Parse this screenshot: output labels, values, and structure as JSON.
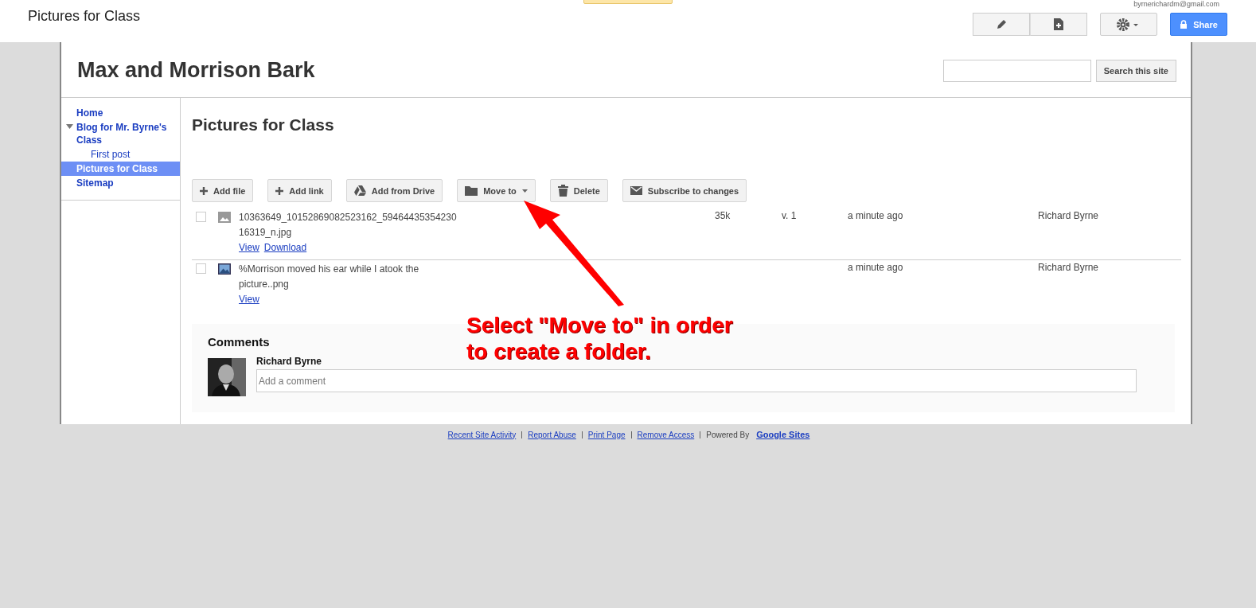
{
  "topbar": {
    "page_title": "Pictures for Class",
    "account": "byrnerichardm@gmail.com",
    "share_label": "Share"
  },
  "site": {
    "title": "Max and Morrison Bark",
    "search": {
      "button": "Search this site"
    }
  },
  "sidebar": {
    "items": [
      {
        "label": "Home",
        "selected": false,
        "expanded": false
      },
      {
        "label": "Blog for Mr. Byrne's Class",
        "selected": false,
        "expanded": true,
        "children": [
          {
            "label": "First post",
            "selected": false
          }
        ]
      },
      {
        "label": "Pictures for Class",
        "selected": true,
        "expanded": false
      },
      {
        "label": "Sitemap",
        "selected": false,
        "expanded": false
      }
    ]
  },
  "page": {
    "heading": "Pictures for Class",
    "toolbar": [
      {
        "kind": "plus",
        "label": "Add file"
      },
      {
        "kind": "plus",
        "label": "Add link"
      },
      {
        "kind": "drive",
        "label": "Add from Drive"
      },
      {
        "kind": "folder",
        "label": "Move to"
      },
      {
        "kind": "trash",
        "label": "Delete"
      },
      {
        "kind": "mail",
        "label": "Subscribe to changes"
      }
    ],
    "files": [
      {
        "name_lines": [
          "10363649_10152869082523162_59464435354230",
          "16319_n.jpg"
        ],
        "kind": "grey",
        "checked": false,
        "size": "35k",
        "version": "v. 1",
        "time": "a minute ago",
        "author": "Richard Byrne",
        "links": [
          "View",
          "Download"
        ]
      },
      {
        "name_lines": [
          "%Morrison moved his ear while I atook the",
          "picture..png"
        ],
        "kind": "color",
        "checked": false,
        "time": "a minute ago",
        "author": "Richard Byrne",
        "links": [
          "View"
        ]
      }
    ],
    "comments": {
      "heading": "Comments",
      "author": "Richard Byrne",
      "placeholder": "Add a comment"
    }
  },
  "footer": {
    "links": [
      "Recent Site Activity",
      "Report Abuse",
      "Print Page",
      "Remove Access"
    ],
    "powered_by": "Powered By",
    "brand": "Google Sites"
  },
  "annotation": {
    "lines": [
      "Select \"Move to\" in order",
      "to create a folder."
    ]
  }
}
